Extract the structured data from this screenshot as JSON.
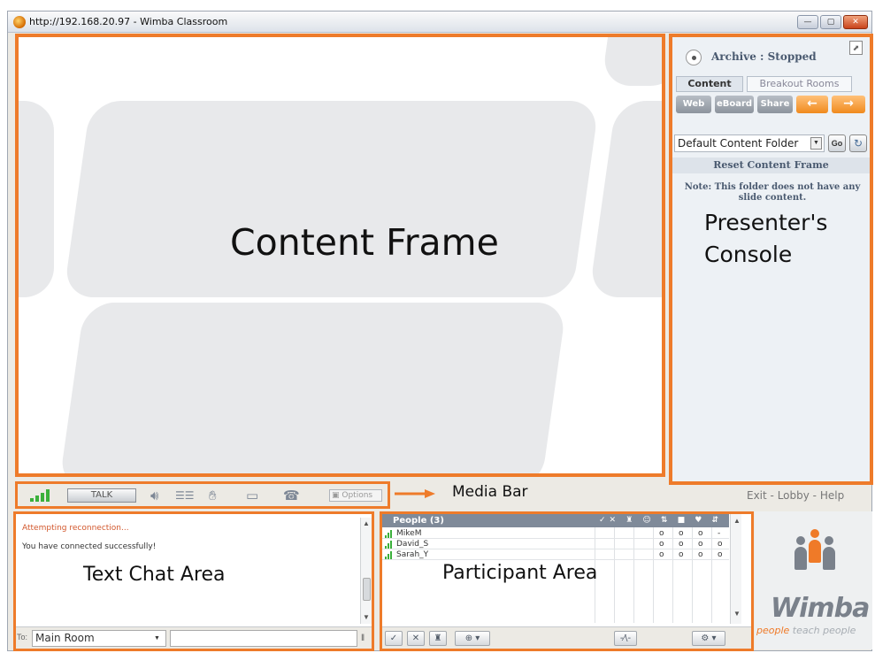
{
  "window": {
    "title": "http://192.168.20.97 - Wimba Classroom",
    "min_glyph": "—",
    "max_glyph": "▢",
    "close_glyph": "✕"
  },
  "content_frame": {
    "label": "Content Frame"
  },
  "console": {
    "archive_status": "Archive : Stopped",
    "tabs": [
      "Content",
      "Breakout Rooms"
    ],
    "buttons": [
      "Web",
      "eBoard",
      "Share",
      "←",
      "→"
    ],
    "folder_select": "Default Content Folder",
    "go_label": "Go",
    "reset_label": "Reset Content Frame",
    "note": "Note: This folder does not have any slide content.",
    "label_line1": "Presenter's",
    "label_line2": "Console"
  },
  "media_bar": {
    "talk_label": "TALK",
    "options_label": "Options",
    "label": "Media Bar",
    "icons": [
      "speaker-icon",
      "equalizer-icon",
      "hand-lock-icon",
      "camera-icon",
      "phone-icon"
    ]
  },
  "footer_links": {
    "exit": "Exit",
    "sep": " - ",
    "lobby": "Lobby",
    "help": "Help"
  },
  "chat": {
    "messages": [
      "Attempting reconnection...",
      "You have connected successfully!"
    ],
    "label": "Text Chat Area",
    "to_label": "To:",
    "room": "Main Room"
  },
  "participants": {
    "header": "People (3)",
    "header_cols": "✓✕ ♜ ☺ ⇅ ■ ♥ ⇵",
    "people": [
      {
        "name": "MikeM",
        "stats": [
          "o",
          "o",
          "o",
          "-"
        ]
      },
      {
        "name": "David_S",
        "stats": [
          "o",
          "o",
          "o",
          "o"
        ]
      },
      {
        "name": "Sarah_Y",
        "stats": [
          "o",
          "o",
          "o",
          "o"
        ]
      }
    ],
    "label": "Participant Area",
    "footer_buttons": [
      "✓",
      "✕",
      "♜",
      "⊕ ▾",
      "-⁄\\-",
      "⚙ ▾"
    ]
  },
  "logo": {
    "word": "Wimba",
    "tagline_orange": "people",
    "tagline_grey": " teach people"
  },
  "colors": {
    "highlight": "#ee7b2a",
    "signal": "#3bb03b"
  }
}
